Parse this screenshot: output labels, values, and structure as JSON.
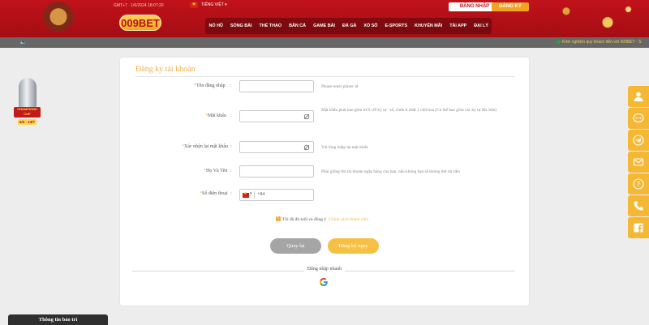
{
  "header": {
    "datetime": "GMT+7 · 1/6/2024 18:07:20",
    "language": "TIẾNG VIỆT ▾",
    "logo": "009BET",
    "login_label": "ĐĂNG NHẬP",
    "register_label": "ĐĂNG KÝ",
    "nav": [
      "NỔ HŨ",
      "SÒNG BÀI",
      "THỂ THAO",
      "BẮN CÁ",
      "GAME BÀI",
      "ĐÁ GÀ",
      "XỔ SỐ",
      "E-SPORTS",
      "KHUYẾN MÃI",
      "TẢI APP",
      "ĐẠI LÝ"
    ]
  },
  "marquee": "Kính nghiệm quý khách đến với 009BET - S",
  "promo": {
    "ribbon": "CHAMPIONS CUP",
    "date": "6/3 - 14/7"
  },
  "form": {
    "title": "Đăng ký tài khoản",
    "username_label": "Tên đăng nhập",
    "username_hint": "Please enter player id",
    "password_label": "Mật khẩu",
    "password_hint": "Mật khẩu phải bao gồm từ 8~20 ký tự : số, chứa ít nhất 1 chữ hoa (Có thể bao gồm các ký tự đặc biệt)",
    "confirm_label": "Xác nhận lại mật khẩu",
    "confirm_hint": "Vui lòng nhập lại mật khẩu",
    "fullname_label": "Họ Và Tên",
    "fullname_hint": "Phải giống tên tài khoản ngân hàng của bạn, nếu không bạn sẽ không thể rút tiền",
    "phone_label": "Số điện thoại",
    "phone_code": "+84",
    "agree_text": "Tôi đã đủ tuổi và đồng ý",
    "agree_link": "Chính sách thành viên",
    "back_label": "Quay lại",
    "submit_label": "Đăng ký ngay",
    "quick_login": "Đăng nhập nhanh"
  },
  "floatbar": [
    "user-icon",
    "chat-icon",
    "telegram-icon",
    "mail-icon",
    "help-icon",
    "phone-icon",
    "facebook-icon"
  ],
  "maintenance_tab": "Thông tin bảo trì",
  "colors": {
    "accent": "#f2b04c",
    "header": "#c1121a",
    "float": "#f5b835"
  }
}
